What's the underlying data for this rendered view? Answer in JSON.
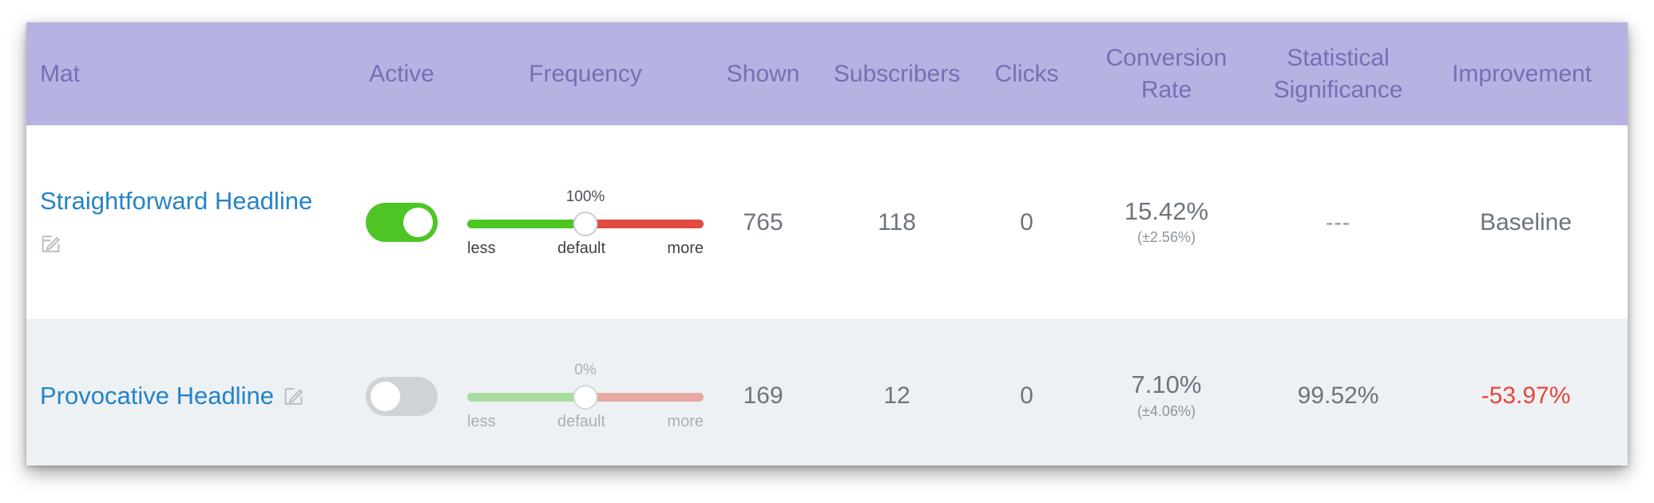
{
  "table": {
    "columns": [
      {
        "key": "mat",
        "label": "Mat"
      },
      {
        "key": "active",
        "label": "Active"
      },
      {
        "key": "frequency",
        "label": "Frequency"
      },
      {
        "key": "shown",
        "label": "Shown"
      },
      {
        "key": "subscribers",
        "label": "Subscribers"
      },
      {
        "key": "clicks",
        "label": "Clicks"
      },
      {
        "key": "conversion",
        "label": "Conversion Rate"
      },
      {
        "key": "significance",
        "label": "Statistical Significance"
      },
      {
        "key": "improvement",
        "label": "Improvement"
      }
    ],
    "rows": [
      {
        "name": "Straightforward Headline",
        "edit_icon": "edit-pencil-icon",
        "active": true,
        "active_state_label": "on",
        "frequency": {
          "value_label": "100%",
          "left_label": "less",
          "center_label": "default",
          "right_label": "more",
          "handle_percent": 50
        },
        "shown": "765",
        "subscribers": "118",
        "clicks": "0",
        "conversion_rate": "15.42%",
        "conversion_margin": "(±2.56%)",
        "significance": "---",
        "improvement": "Baseline"
      },
      {
        "name": "Provocative Headline",
        "edit_icon": "edit-pencil-icon",
        "active": false,
        "active_state_label": "off",
        "frequency": {
          "value_label": "0%",
          "left_label": "less",
          "center_label": "default",
          "right_label": "more",
          "handle_percent": 50
        },
        "shown": "169",
        "subscribers": "12",
        "clicks": "0",
        "conversion_rate": "7.10%",
        "conversion_margin": "(±4.06%)",
        "significance": "99.52%",
        "improvement": "-53.97%"
      }
    ]
  },
  "colors": {
    "header_background": "#b6b3e3",
    "header_text": "#7570b3",
    "link": "#2484c6",
    "toggle_on": "#4cc525",
    "toggle_off": "#cdd3d7",
    "slider_low": "#4cc525",
    "slider_high": "#e04a41",
    "slider_low_muted": "#a9dda0",
    "slider_high_muted": "#e7a8a3",
    "negative": "#e8453c",
    "row_alt_background": "#edf1f4",
    "body_text": "#6d747c"
  }
}
